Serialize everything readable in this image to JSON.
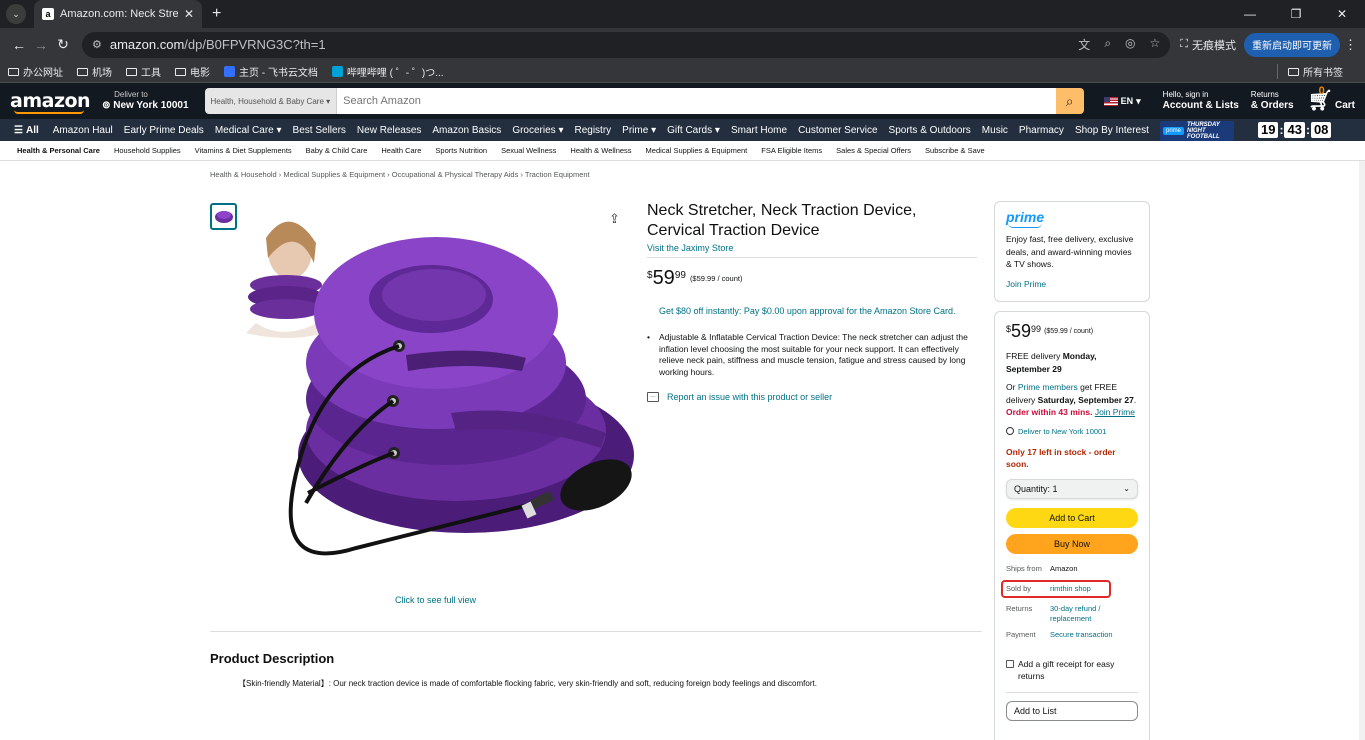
{
  "browser": {
    "tab_title": "Amazon.com: Neck Stretcher",
    "new_tab": "+",
    "url_host": "amazon.com",
    "url_path": "/dp/B0FPVRNG3C?th=1",
    "incognito_label": "无痕模式",
    "update_button": "重新启动即可更新",
    "bookmarks": [
      "办公网址",
      "机场",
      "工具",
      "电影",
      "主页 - 飞书云文档",
      "哔哩哔哩 ( ゜- ゜)つ..."
    ],
    "all_bookmarks": "所有书签"
  },
  "header": {
    "logo": "amazon",
    "deliver_line1": "Deliver to",
    "deliver_line2": "New York 10001",
    "search_category": "Health, Household & Baby Care",
    "search_placeholder": "Search Amazon",
    "language": "EN",
    "account_line1": "Hello, sign in",
    "account_line2": "Account & Lists",
    "orders_line1": "Returns",
    "orders_line2": "& Orders",
    "cart_count": "0",
    "cart_label": "Cart"
  },
  "nav": {
    "all": "All",
    "items": [
      "Amazon Haul",
      "Early Prime Deals",
      "Medical Care",
      "Best Sellers",
      "New Releases",
      "Amazon Basics",
      "Groceries",
      "Registry",
      "Prime",
      "Gift Cards",
      "Smart Home",
      "Customer Service",
      "Sports & Outdoors",
      "Music",
      "Pharmacy",
      "Shop By Interest"
    ],
    "promo_prime": "prime",
    "promo_text": "THURSDAY NIGHT FOOTBALL",
    "clock": [
      "19",
      "43",
      "08"
    ]
  },
  "subnav": [
    "Health & Personal Care",
    "Household Supplies",
    "Vitamins & Diet Supplements",
    "Baby & Child Care",
    "Health Care",
    "Sports Nutrition",
    "Sexual Wellness",
    "Health & Wellness",
    "Medical Supplies & Equipment",
    "FSA Eligible Items",
    "Sales & Special Offers",
    "Subscribe & Save"
  ],
  "breadcrumb": "Health & Household › Medical Supplies & Equipment › Occupational & Physical Therapy Aids › Traction Equipment",
  "product": {
    "title": "Neck Stretcher, Neck Traction Device, Cervical Traction Device",
    "store": "Visit the Jaximy Store",
    "price_currency": "$",
    "price_whole": "59",
    "price_fraction": "99",
    "price_unit": "($59.99 / count)",
    "promo": "Get $80 off instantly: Pay $0.00 upon approval for the Amazon Store Card.",
    "bullet": "Adjustable & Inflatable Cervical Traction Device: The neck stretcher can adjust the inflation level choosing the most suitable for your neck support. It can effectively relieve neck pain, stiffness and muscle tension, fatigue and stress caused by long working hours.",
    "report": "Report an issue with this product or seller",
    "full_view": "Click to see full view"
  },
  "description": {
    "heading": "Product Description",
    "text": "【Skin-friendly Material】: Our neck traction device is made of comfortable flocking fabric, very skin-friendly and soft, reducing foreign body feelings and discomfort."
  },
  "prime_box": {
    "logo": "prime",
    "text": "Enjoy fast, free delivery, exclusive deals, and award-winning movies & TV shows.",
    "join": "Join Prime"
  },
  "buy_box": {
    "delivery_prefix": "FREE delivery ",
    "delivery_date": "Monday, September 29",
    "prime_or": "Or ",
    "prime_members": "Prime members",
    "prime_get": " get FREE delivery ",
    "prime_date": "Saturday, September 27",
    "prime_period": ". ",
    "order_within": "Order within 43 mins.",
    "join_prime": "Join Prime",
    "deliver_to": "Deliver to New York 10001",
    "stock": "Only 17 left in stock - order soon.",
    "quantity": "Quantity: 1",
    "add_to_cart": "Add to Cart",
    "buy_now": "Buy Now",
    "ships_from_k": "Ships from",
    "ships_from_v": "Amazon",
    "sold_by_k": "Sold by",
    "sold_by_v": "rimthin shop",
    "returns_k": "Returns",
    "returns_v": "30-day refund / replacement",
    "payment_k": "Payment",
    "payment_v": "Secure transaction",
    "gift": "Add a gift receipt for easy returns",
    "add_to_list": "Add to List"
  }
}
